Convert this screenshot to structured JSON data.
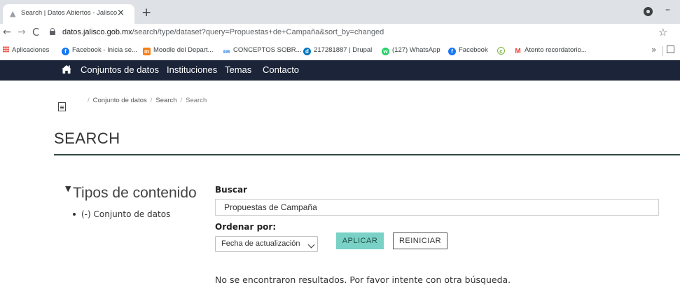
{
  "browser": {
    "tab_title": "Search | Datos Abiertos - Jalisco",
    "tab_close": "×",
    "new_tab": "+",
    "minimize": "–",
    "back": "←",
    "forward": "→",
    "reload": "C",
    "star": "☆",
    "url_host": "datos.jalisco.gob.mx",
    "url_path": "/search/type/dataset?query=Propuestas+de+Campaña&sort_by=changed"
  },
  "bookmarks": {
    "items": [
      {
        "label": "Aplicaciones",
        "icon": "apps-grid-icon",
        "color": "#ea4335"
      },
      {
        "label": "Facebook - Inicia se...",
        "icon": "facebook-icon",
        "color": "#1877f2"
      },
      {
        "label": "Moodle del Depart...",
        "icon": "moodle-icon",
        "color": "#f98012"
      },
      {
        "label": "CONCEPTOS SOBR...",
        "icon": "em-vi-icon",
        "color": "#1a73e8"
      },
      {
        "label": "217281887 | Drupal",
        "icon": "drupal-icon",
        "color": "#0678be"
      },
      {
        "label": "(127) WhatsApp",
        "icon": "whatsapp-icon",
        "color": "#25d366"
      },
      {
        "label": "Facebook",
        "icon": "facebook-icon",
        "color": "#1877f2"
      },
      {
        "label": "",
        "icon": "copyright-icon",
        "color": "#7cb342"
      },
      {
        "label": "Atento recordatorio...",
        "icon": "gmail-icon",
        "color": "#ea4335"
      }
    ],
    "more": "»"
  },
  "sitenav": {
    "links": [
      "Conjuntos de datos",
      "Instituciones",
      "Temas",
      "Contacto"
    ],
    "background": "#1b2438"
  },
  "breadcrumb": {
    "items": [
      "Conjunto de datos",
      "Search",
      "Search"
    ],
    "sep": "/"
  },
  "page": {
    "title": "SEARCH"
  },
  "facets": {
    "title": "Tipos de contenido",
    "items": [
      "(-) Conjunto de datos"
    ]
  },
  "search": {
    "label": "Buscar",
    "value": "Propuestas de Campaña",
    "sort_label": "Ordenar por:",
    "sort_selected": "Fecha de actualización",
    "apply_label": "APLICAR",
    "reset_label": "REINICIAR",
    "accent": "#7ad1c6"
  },
  "results": {
    "message": "No se encontraron resultados. Por favor intente con otra búsqueda."
  }
}
